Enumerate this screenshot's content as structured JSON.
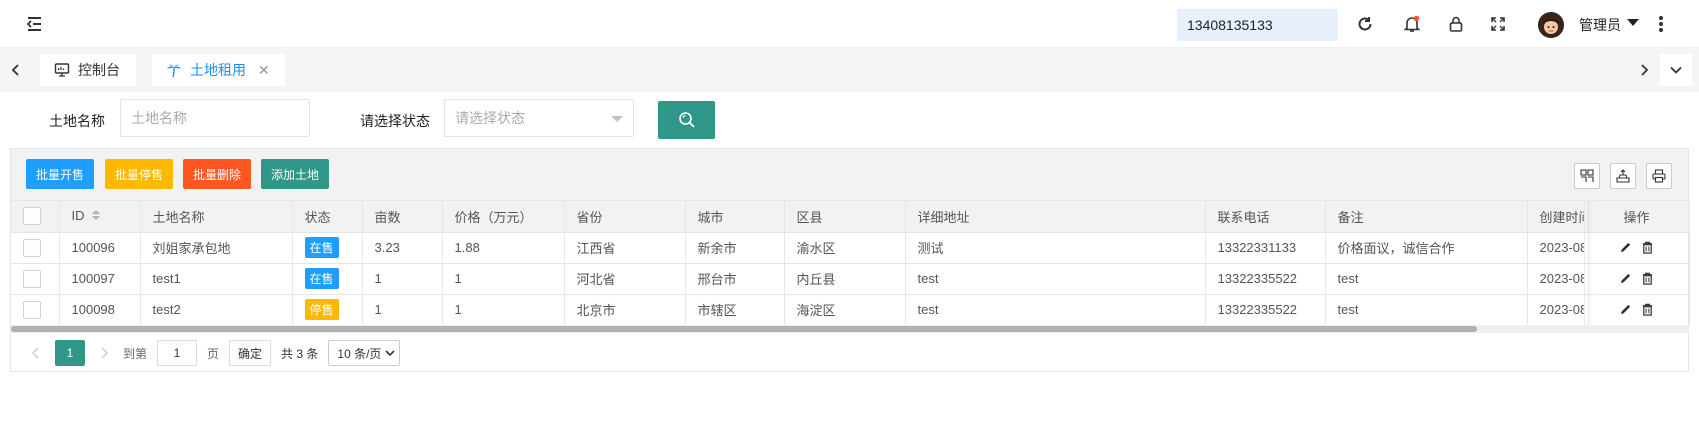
{
  "header": {
    "phone": "13408135133",
    "user_name": "管理员"
  },
  "tabs": {
    "console": "控制台",
    "land_rent": "土地租用",
    "close_symbol": "✕"
  },
  "search": {
    "name_label": "土地名称",
    "name_placeholder": "土地名称",
    "status_label": "请选择状态",
    "status_placeholder": "请选择状态"
  },
  "toolbar": {
    "batch_on_sale": "批量开售",
    "batch_stop_sale": "批量停售",
    "batch_delete": "批量删除",
    "add_land": "添加土地"
  },
  "colors": {
    "accent": "#2f9688",
    "blue": "#1e9fff",
    "orange": "#ffb800",
    "red": "#ff5722",
    "status_on": "#1e9fff",
    "status_off": "#ffb800"
  },
  "table": {
    "headers": {
      "id": "ID",
      "name": "土地名称",
      "status": "状态",
      "area": "亩数",
      "price": "价格（万元）",
      "province": "省份",
      "city": "城市",
      "district": "区县",
      "address": "详细地址",
      "phone": "联系电话",
      "remark": "备注",
      "created": "创建时间",
      "ops": "操作"
    },
    "rows": [
      {
        "id": "100096",
        "name": "刘姐家承包地",
        "status": "在售",
        "status_type": "on",
        "area": "3.23",
        "price": "1.88",
        "province": "江西省",
        "city": "新余市",
        "district": "渝水区",
        "address": "测试",
        "phone": "13322331133",
        "remark": "价格面议，诚信合作",
        "created": "2023-08"
      },
      {
        "id": "100097",
        "name": "test1",
        "status": "在售",
        "status_type": "on",
        "area": "1",
        "price": "1",
        "province": "河北省",
        "city": "邢台市",
        "district": "内丘县",
        "address": "test",
        "phone": "13322335522",
        "remark": "test",
        "created": "2023-08"
      },
      {
        "id": "100098",
        "name": "test2",
        "status": "停售",
        "status_type": "off",
        "area": "1",
        "price": "1",
        "province": "北京市",
        "city": "市辖区",
        "district": "海淀区",
        "address": "test",
        "phone": "13322335522",
        "remark": "test",
        "created": "2023-08"
      }
    ]
  },
  "pager": {
    "current_page": "1",
    "goto_label": "到第",
    "goto_value": "1",
    "page_unit": "页",
    "confirm": "确定",
    "total": "共 3 条",
    "page_size": "10 条/页"
  }
}
